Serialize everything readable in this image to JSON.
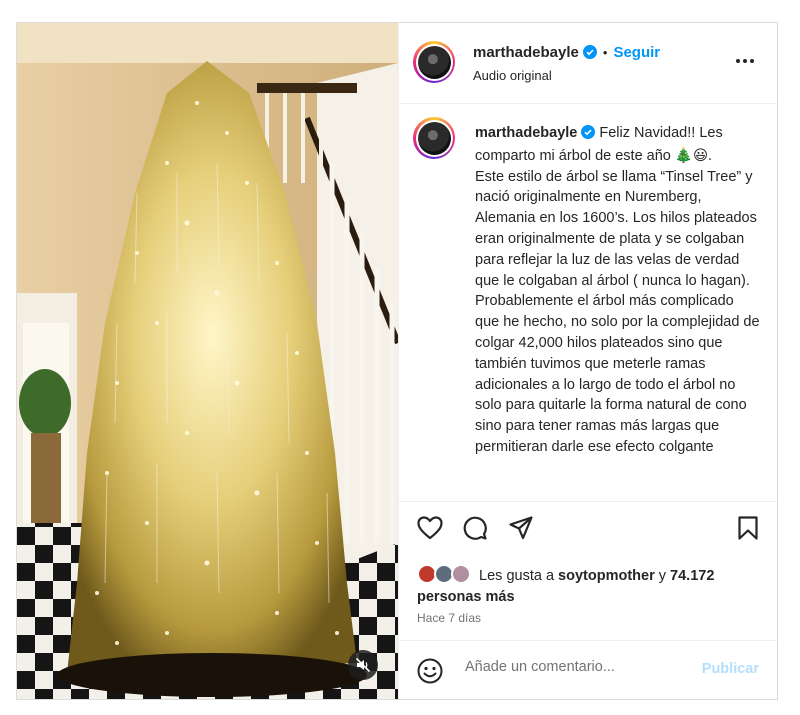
{
  "post": {
    "author": {
      "username": "marthadebayle",
      "verified": true,
      "follow_label": "Seguir",
      "separator": "•",
      "audio_label": "Audio original"
    },
    "caption": {
      "username": "marthadebayle",
      "text": "Feliz Navidad!! Les comparto mi árbol de este año 🎄😃.\nEste estilo de árbol se llama “Tinsel Tree” y nació originalmente en Nuremberg, Alemania en los 1600’s. Los hilos plateados eran originalmente de plata y se colgaban para reflejar la luz de las velas de verdad que le colgaban al árbol ( nunca lo hagan).\nProbablemente el árbol más complicado que he hecho, no solo por la complejidad de colgar 42,000 hilos plateados sino que también tuvimos que meterle ramas adicionales a lo largo de todo el árbol no solo para quitarle la forma natural de cono sino para tener ramas más largas que permitieran darle ese efecto colgante"
    },
    "likes": {
      "prefix": "Les gusta a",
      "liker": "soytopmother",
      "connector": "y",
      "count_text": "74.172 personas más"
    },
    "timestamp": "Hace 7 días",
    "comment": {
      "placeholder": "Añade un comentario...",
      "publish_label": "Publicar"
    }
  },
  "icons": {
    "more": "more-horizontal-icon",
    "like": "heart-icon",
    "comment": "comment-icon",
    "share": "paper-plane-icon",
    "save": "bookmark-icon",
    "emoji": "smiley-icon",
    "mute": "speaker-muted-icon",
    "verified": "verified-badge-icon"
  },
  "colors": {
    "accent": "#0095f6",
    "publish_disabled": "#b2dffc",
    "border": "#dbdbdb",
    "secondary_text": "#737373"
  }
}
